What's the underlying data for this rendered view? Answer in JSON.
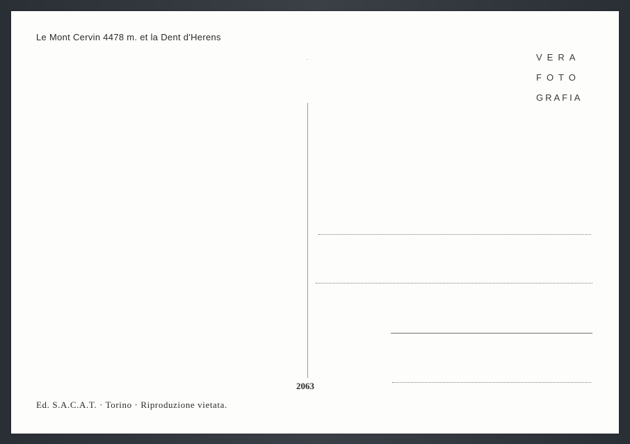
{
  "postcard": {
    "caption": "Le Mont Cervin 4478 m. et la Dent d'Herens",
    "logo": {
      "line1": "VERA",
      "line2": "FOTO",
      "line3": "GRAFIA"
    },
    "serial_number": "2063",
    "publisher_line": "Ed. S.A.C.A.T. · Torino · Riproduzione vietata."
  }
}
